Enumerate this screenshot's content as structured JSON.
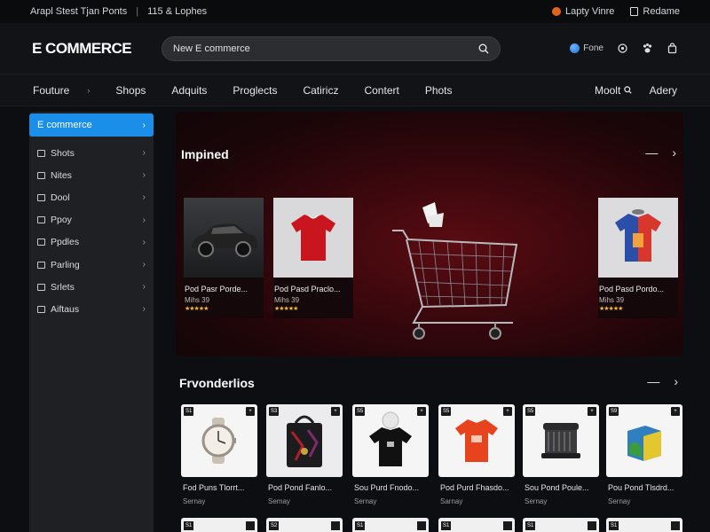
{
  "topbar": {
    "left_text": "Arapl Stest Tjan Ponts",
    "right_text": "115 & Lophes",
    "links": [
      "Lapty Vinre",
      "Redame"
    ]
  },
  "header": {
    "logo": "E COMMERCE",
    "search": {
      "placeholder": "New E commerce"
    },
    "region": "Fone"
  },
  "nav": {
    "items": [
      "Fouture",
      "Shops",
      "Adquits",
      "Proglects",
      "Catiricz",
      "Contert",
      "Phots"
    ],
    "right": [
      "Moolt",
      "Adery"
    ]
  },
  "sidebar": {
    "active": "E commerce",
    "items": [
      "Shots",
      "Nites",
      "Dool",
      "Ppoy",
      "Ppdles",
      "Parling",
      "Srlets",
      "Aiftaus"
    ]
  },
  "featured": {
    "title": "Impined",
    "items": [
      {
        "title": "Pod Pasr Porde...",
        "price": "Mihs 39",
        "stars": "★★★★★",
        "icon": "car-image"
      },
      {
        "title": "Pod Pasd Praclo...",
        "price": "Mihs 39",
        "stars": "★★★★★",
        "icon": "red-shirt-image"
      },
      {
        "title": "Pod Pasd Pordo...",
        "price": "Mihs 39",
        "stars": "★★★★★",
        "icon": "colorful-shirt-image"
      }
    ]
  },
  "promotions": {
    "title": "Frvonderlios",
    "items": [
      {
        "badge": "S1",
        "title": "Fod Puns Tlorrt...",
        "sub": "Sernay",
        "icon": "watch-image"
      },
      {
        "badge": "S3",
        "title": "Pod Pond Fanlo...",
        "sub": "Semay",
        "icon": "bag-image"
      },
      {
        "badge": "S5",
        "title": "Sou Purd Fnodo...",
        "sub": "Sernay",
        "icon": "tshirt-image"
      },
      {
        "badge": "S5",
        "title": "Pod Purd Fhasdo...",
        "sub": "Sarnay",
        "icon": "orange-shirt-image"
      },
      {
        "badge": "S5",
        "title": "Sou Pond Poule...",
        "sub": "Sernay",
        "icon": "device-image"
      },
      {
        "badge": "S9",
        "title": "Pou Pond Tlsdrd...",
        "sub": "Sernay",
        "icon": "box-image"
      }
    ]
  },
  "colors": {
    "accent": "#1a8ee8",
    "background": "#0d0e11",
    "featured_bg": "#33070c",
    "star": "#f4b73c"
  }
}
